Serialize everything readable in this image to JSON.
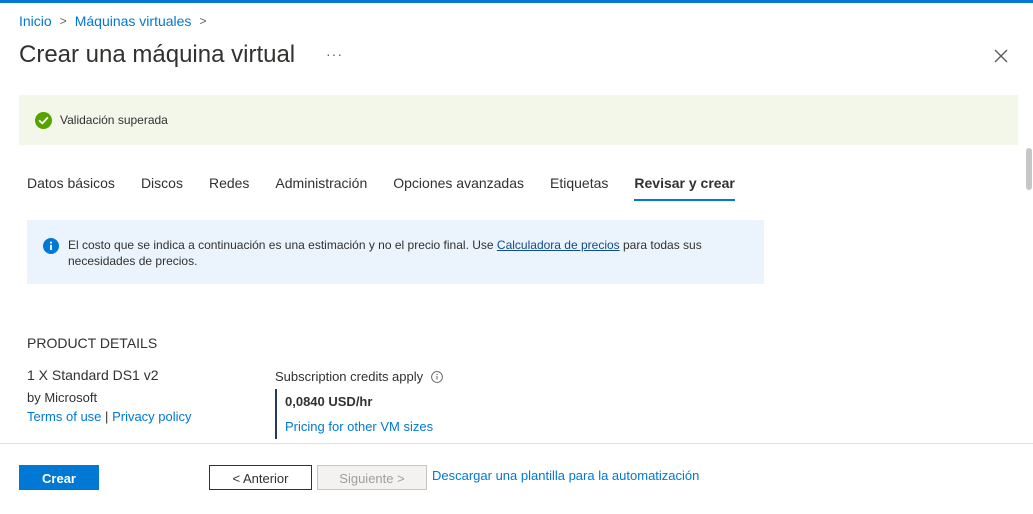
{
  "breadcrumb": {
    "home": "Inicio",
    "vms": "Máquinas virtuales",
    "separator": ">"
  },
  "header": {
    "title": "Crear una máquina virtual",
    "more": "···"
  },
  "validation": {
    "text": "Validación superada",
    "color": "#107c10"
  },
  "tabs": [
    {
      "label": "Datos básicos"
    },
    {
      "label": "Discos"
    },
    {
      "label": "Redes"
    },
    {
      "label": "Administración"
    },
    {
      "label": "Opciones avanzadas"
    },
    {
      "label": "Etiquetas"
    },
    {
      "label": "Revisar y crear",
      "active": true
    }
  ],
  "info": {
    "text_before": "El costo que se indica a continuación es una estimación y no el precio final. Use ",
    "link": "Calculadora de precios",
    "text_after": " para todas sus necesidades de precios."
  },
  "product": {
    "section_title": "PRODUCT DETAILS",
    "name": "1 X Standard DS1 v2",
    "by": "by Microsoft",
    "terms": "Terms of use",
    "divider": "|",
    "privacy": "Privacy policy",
    "credits": "Subscription credits apply",
    "price": "0,0840 USD/hr",
    "pricing_link": "Pricing for other VM sizes"
  },
  "footer": {
    "create": "Crear",
    "previous": "< Anterior",
    "next": "Siguiente >",
    "download": "Descargar una plantilla para la automatización"
  },
  "colors": {
    "accent": "#0078d4",
    "success_bg": "#f2f7ea",
    "info_bg": "#ebf3fc"
  }
}
